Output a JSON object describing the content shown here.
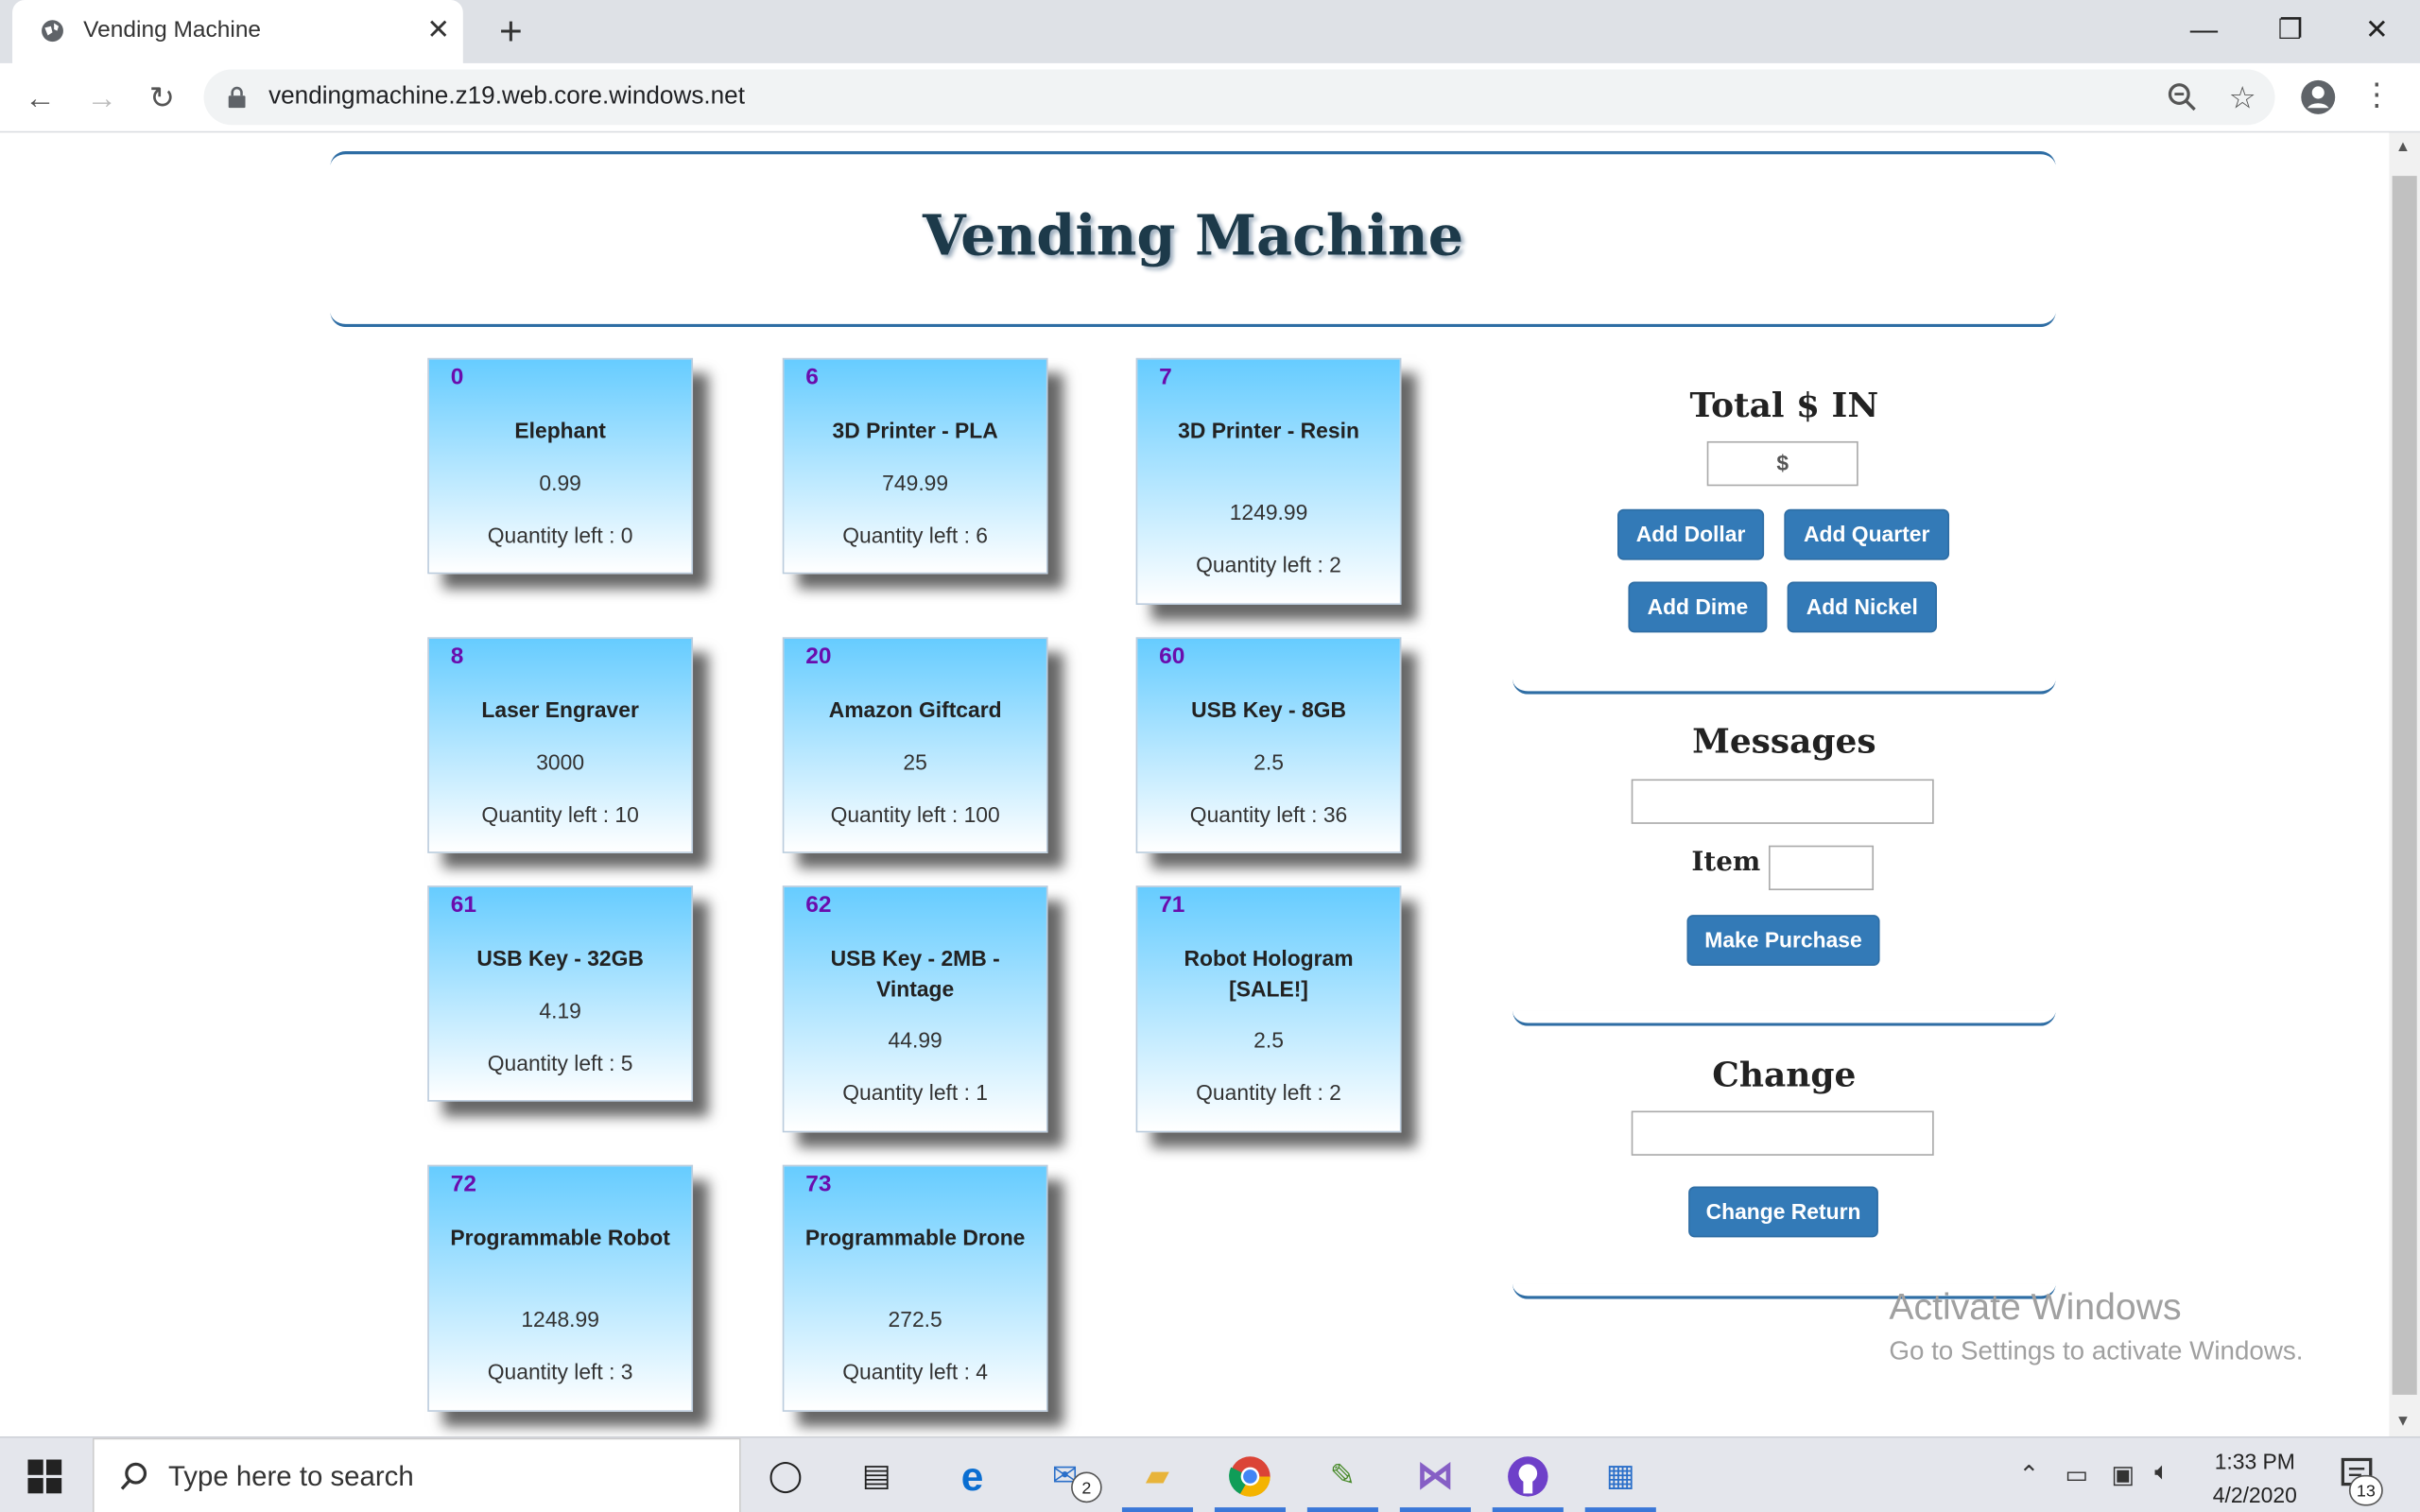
{
  "browser": {
    "tab_title": "Vending Machine",
    "url": "vendingmachine.z19.web.core.windows.net"
  },
  "page": {
    "title": "Vending Machine",
    "items": [
      {
        "id": "0",
        "name": "Elephant",
        "price": "0.99",
        "quantity": "Quantity left : 0"
      },
      {
        "id": "6",
        "name": "3D Printer - PLA",
        "price": "749.99",
        "quantity": "Quantity left : 6"
      },
      {
        "id": "7",
        "name": "3D Printer - Resin",
        "price": "1249.99",
        "quantity": "Quantity left : 2"
      },
      {
        "id": "8",
        "name": "Laser Engraver",
        "price": "3000",
        "quantity": "Quantity left : 10"
      },
      {
        "id": "20",
        "name": "Amazon Giftcard",
        "price": "25",
        "quantity": "Quantity left : 100"
      },
      {
        "id": "60",
        "name": "USB Key - 8GB",
        "price": "2.5",
        "quantity": "Quantity left : 36"
      },
      {
        "id": "61",
        "name": "USB Key - 32GB",
        "price": "4.19",
        "quantity": "Quantity left : 5"
      },
      {
        "id": "62",
        "name": "USB Key - 2MB - Vintage",
        "price": "44.99",
        "quantity": "Quantity left : 1"
      },
      {
        "id": "71",
        "name": "Robot Hologram [SALE!]",
        "price": "2.5",
        "quantity": "Quantity left : 2"
      },
      {
        "id": "72",
        "name": "Programmable Robot",
        "price": "1248.99",
        "quantity": "Quantity left : 3"
      },
      {
        "id": "73",
        "name": "Programmable Drone",
        "price": "272.5",
        "quantity": "Quantity left : 4"
      }
    ],
    "money": {
      "title": "Total $ IN",
      "field_value": "$",
      "add_dollar": "Add Dollar",
      "add_quarter": "Add Quarter",
      "add_dime": "Add Dime",
      "add_nickel": "Add Nickel"
    },
    "messages": {
      "title": "Messages",
      "value": "",
      "item_label": "Item :",
      "item_value": "",
      "purchase_button": "Make Purchase"
    },
    "change": {
      "title": "Change",
      "value": "",
      "return_button": "Change Return"
    },
    "watermark": {
      "line1": "Activate Windows",
      "line2": "Go to Settings to activate Windows."
    }
  },
  "taskbar": {
    "search_placeholder": "Type here to search",
    "mail_badge": "2",
    "time": "1:33 PM",
    "date": "4/2/2020",
    "notification_count": "13"
  },
  "colors": {
    "accent": "#337ab7",
    "item_id": "#6a0dad",
    "card_top": "#66ccff"
  }
}
